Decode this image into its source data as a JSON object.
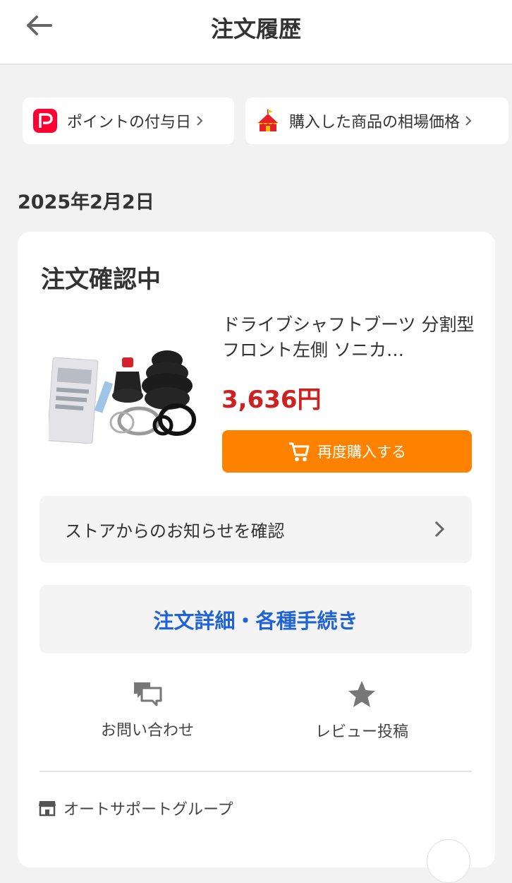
{
  "header": {
    "title": "注文履歴",
    "back_icon": "arrow-left-icon"
  },
  "chips": [
    {
      "label": "ポイントの付与日",
      "icon": "paypay-icon",
      "color": "#ff0033"
    },
    {
      "label": "購入した商品の相場価格",
      "icon": "tent-icon",
      "color": "#e8202a"
    }
  ],
  "order": {
    "date": "2025年2月2日",
    "status": "注文確認中",
    "product": {
      "name": "ドライブシャフトブーツ 分割型 フロント左側 ソニカ…",
      "price": "3,636円",
      "image_icon": "boot-kit-image"
    },
    "rebuy_label": "再度購入する",
    "store_notice_label": "ストアからのお知らせを確認",
    "order_detail_label": "注文詳細・各種手続き",
    "actions": [
      {
        "label": "お問い合わせ",
        "icon": "chat-icon"
      },
      {
        "label": "レビュー投稿",
        "icon": "star-icon"
      }
    ],
    "store_name": "オートサポートグループ"
  },
  "colors": {
    "accent_orange": "#ff8100",
    "price_red": "#cc2222",
    "link_blue": "#1f63d6",
    "background": "#f2f2f2"
  }
}
